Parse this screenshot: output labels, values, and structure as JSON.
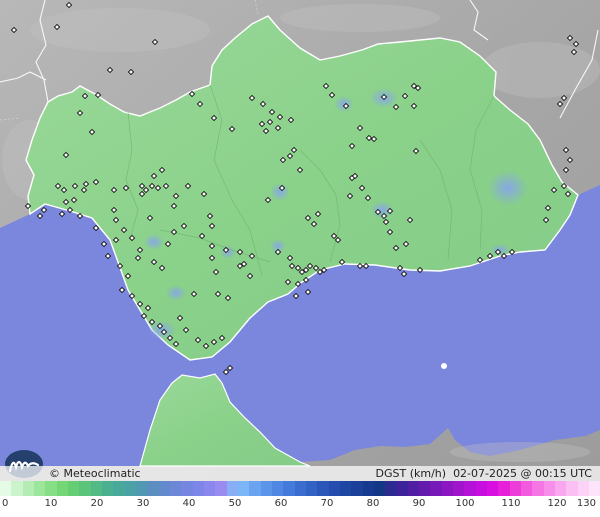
{
  "header": {
    "copyright": "© Meteoclimatic",
    "variable": "DGST (km/h)",
    "datetime": "02-07-2025 @ 00:15 UTC"
  },
  "legend": {
    "ticks": [
      "0",
      "10",
      "20",
      "30",
      "40",
      "50",
      "60",
      "70",
      "80",
      "90",
      "100",
      "110",
      "120",
      "130"
    ],
    "colors": [
      "#e6fbe6",
      "#ccf4cc",
      "#b3edb3",
      "#9be69b",
      "#86de86",
      "#74d674",
      "#65ce72",
      "#5ac47a",
      "#52ba84",
      "#4bb08f",
      "#48a89a",
      "#4aa1a6",
      "#5198b3",
      "#5a8fc0",
      "#638acc",
      "#6c87d6",
      "#7585e0",
      "#7e85e8",
      "#8a87ee",
      "#9a8bf1",
      "#88aef6",
      "#7cb6f6",
      "#6aa4f0",
      "#5b95ea",
      "#4f87e2",
      "#447ad9",
      "#3a6dcf",
      "#3262c4",
      "#2b57b8",
      "#244dad",
      "#1e46a3",
      "#1a4099",
      "#163a8f",
      "#133685",
      "#2a2a8f",
      "#3d2399",
      "#4f1ea3",
      "#631aad",
      "#7718b8",
      "#8c16c2",
      "#a014cc",
      "#b412d6",
      "#c60fde",
      "#d80fe0",
      "#e520d8",
      "#ec3dd8",
      "#f25ade",
      "#f575e4",
      "#f78fea",
      "#f9a8ef",
      "#fbbff4",
      "#fcd3f7",
      "#fde4fa"
    ]
  },
  "colors": {
    "sea": "#7b86dd",
    "neighbour_land": "#aaaaaa",
    "andalusia_land": "#86d486",
    "wind_hotspot": "#86a4ee"
  },
  "stations_count": 250
}
